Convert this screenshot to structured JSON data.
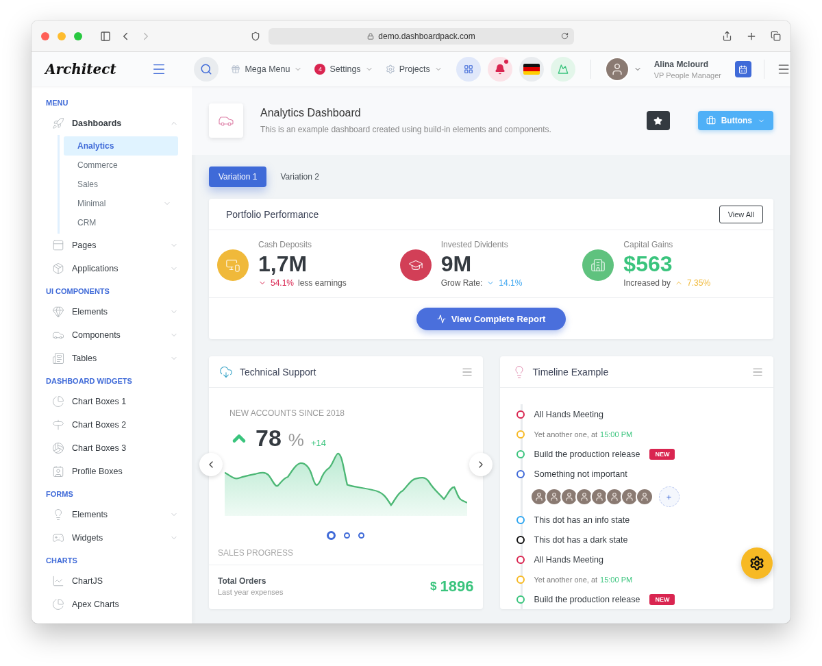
{
  "browser": {
    "url": "demo.dashboardpack.com"
  },
  "header": {
    "logo": "Architect",
    "nav": [
      {
        "label": "Mega Menu"
      },
      {
        "label": "Settings",
        "badge": "4"
      },
      {
        "label": "Projects"
      }
    ],
    "has_notification": true,
    "user": {
      "name": "Alina Mclourd",
      "role": "VP People Manager"
    }
  },
  "sidebar": {
    "sections": [
      {
        "heading": "MENU",
        "items": [
          {
            "label": "Dashboards",
            "expandable": true,
            "expanded": true,
            "children": [
              {
                "label": "Analytics",
                "selected": true,
                "expandable": false
              },
              {
                "label": "Commerce",
                "selected": false,
                "expandable": false
              },
              {
                "label": "Sales",
                "selected": false,
                "expandable": false
              },
              {
                "label": "Minimal",
                "selected": false,
                "expandable": true
              },
              {
                "label": "CRM",
                "selected": false,
                "expandable": false
              }
            ]
          },
          {
            "label": "Pages",
            "expandable": true,
            "expanded": false
          },
          {
            "label": "Applications",
            "expandable": true,
            "expanded": false
          }
        ]
      },
      {
        "heading": "UI COMPONENTS",
        "items": [
          {
            "label": "Elements",
            "expandable": true,
            "expanded": false
          },
          {
            "label": "Components",
            "expandable": true,
            "expanded": false
          },
          {
            "label": "Tables",
            "expandable": true,
            "expanded": false
          }
        ]
      },
      {
        "heading": "DASHBOARD WIDGETS",
        "items": [
          {
            "label": "Chart Boxes 1",
            "expandable": false
          },
          {
            "label": "Chart Boxes 2",
            "expandable": false
          },
          {
            "label": "Chart Boxes 3",
            "expandable": false
          },
          {
            "label": "Profile Boxes",
            "expandable": false
          }
        ]
      },
      {
        "heading": "FORMS",
        "items": [
          {
            "label": "Elements",
            "expandable": true,
            "expanded": false
          },
          {
            "label": "Widgets",
            "expandable": true,
            "expanded": false
          }
        ]
      },
      {
        "heading": "CHARTS",
        "items": [
          {
            "label": "ChartJS",
            "expandable": false
          },
          {
            "label": "Apex Charts",
            "expandable": false
          }
        ]
      }
    ]
  },
  "page": {
    "title": "Analytics Dashboard",
    "subtitle": "This is an example dashboard created using build-in elements and components.",
    "button": "Buttons"
  },
  "tabs": [
    {
      "label": "Variation 1",
      "selected": true
    },
    {
      "label": "Variation 2",
      "selected": false
    }
  ],
  "portfolio": {
    "title": "Portfolio Performance",
    "view_all": "View All",
    "report_button": "View Complete Report",
    "stats": [
      {
        "label": "Cash Deposits",
        "value": "1,7M",
        "highlight": false,
        "color": "#f0b93a",
        "change": {
          "text": "54.1%",
          "up": false,
          "color": "#d92550"
        },
        "after": "less earnings"
      },
      {
        "label": "Invested Dividents",
        "value": "9M",
        "highlight": false,
        "color": "#d23f57",
        "change": {
          "text": "14.1%",
          "up": false,
          "color": "#3fa7f0"
        },
        "before": "Grow Rate:"
      },
      {
        "label": "Capital Gains",
        "value": "$563",
        "highlight": true,
        "color": "#5fc27e",
        "change": {
          "text": "7.35%",
          "up": true,
          "color": "#f0b93a"
        },
        "before": "Increased by"
      }
    ]
  },
  "support": {
    "title": "Technical Support",
    "caption": "NEW ACCOUNTS SINCE 2018",
    "value": "78",
    "unit": "%",
    "delta": "+14",
    "slides": [
      {
        "selected": true
      },
      {
        "selected": false
      },
      {
        "selected": false
      }
    ],
    "section_label": "SALES PROGRESS",
    "orders": {
      "title": "Total Orders",
      "subtitle": "Last year expenses",
      "currency": "$",
      "value": "1896"
    }
  },
  "timeline": {
    "title": "Timeline Example",
    "items": [
      {
        "kind": "event",
        "text": "All Hands Meeting",
        "color": "#d92550"
      },
      {
        "kind": "note",
        "text": "Yet another one, at",
        "time": "15:00 PM",
        "color": "#f7b924"
      },
      {
        "kind": "event",
        "text": "Build the production release",
        "badge": "NEW",
        "color": "#3ac47d"
      },
      {
        "kind": "event",
        "text": "Something not important",
        "color": "#3f6ad8"
      },
      {
        "kind": "avatars",
        "add": "+"
      },
      {
        "kind": "event",
        "text": "This dot has an info state",
        "color": "#30a6f0"
      },
      {
        "kind": "event",
        "text": "This dot has a dark state",
        "color": "#111111"
      },
      {
        "kind": "event",
        "text": "All Hands Meeting",
        "color": "#d92550"
      },
      {
        "kind": "note",
        "text": "Yet another one, at",
        "time": "15:00 PM",
        "color": "#f7b924"
      },
      {
        "kind": "event",
        "text": "Build the production release",
        "badge": "NEW",
        "color": "#3ac47d"
      }
    ]
  }
}
